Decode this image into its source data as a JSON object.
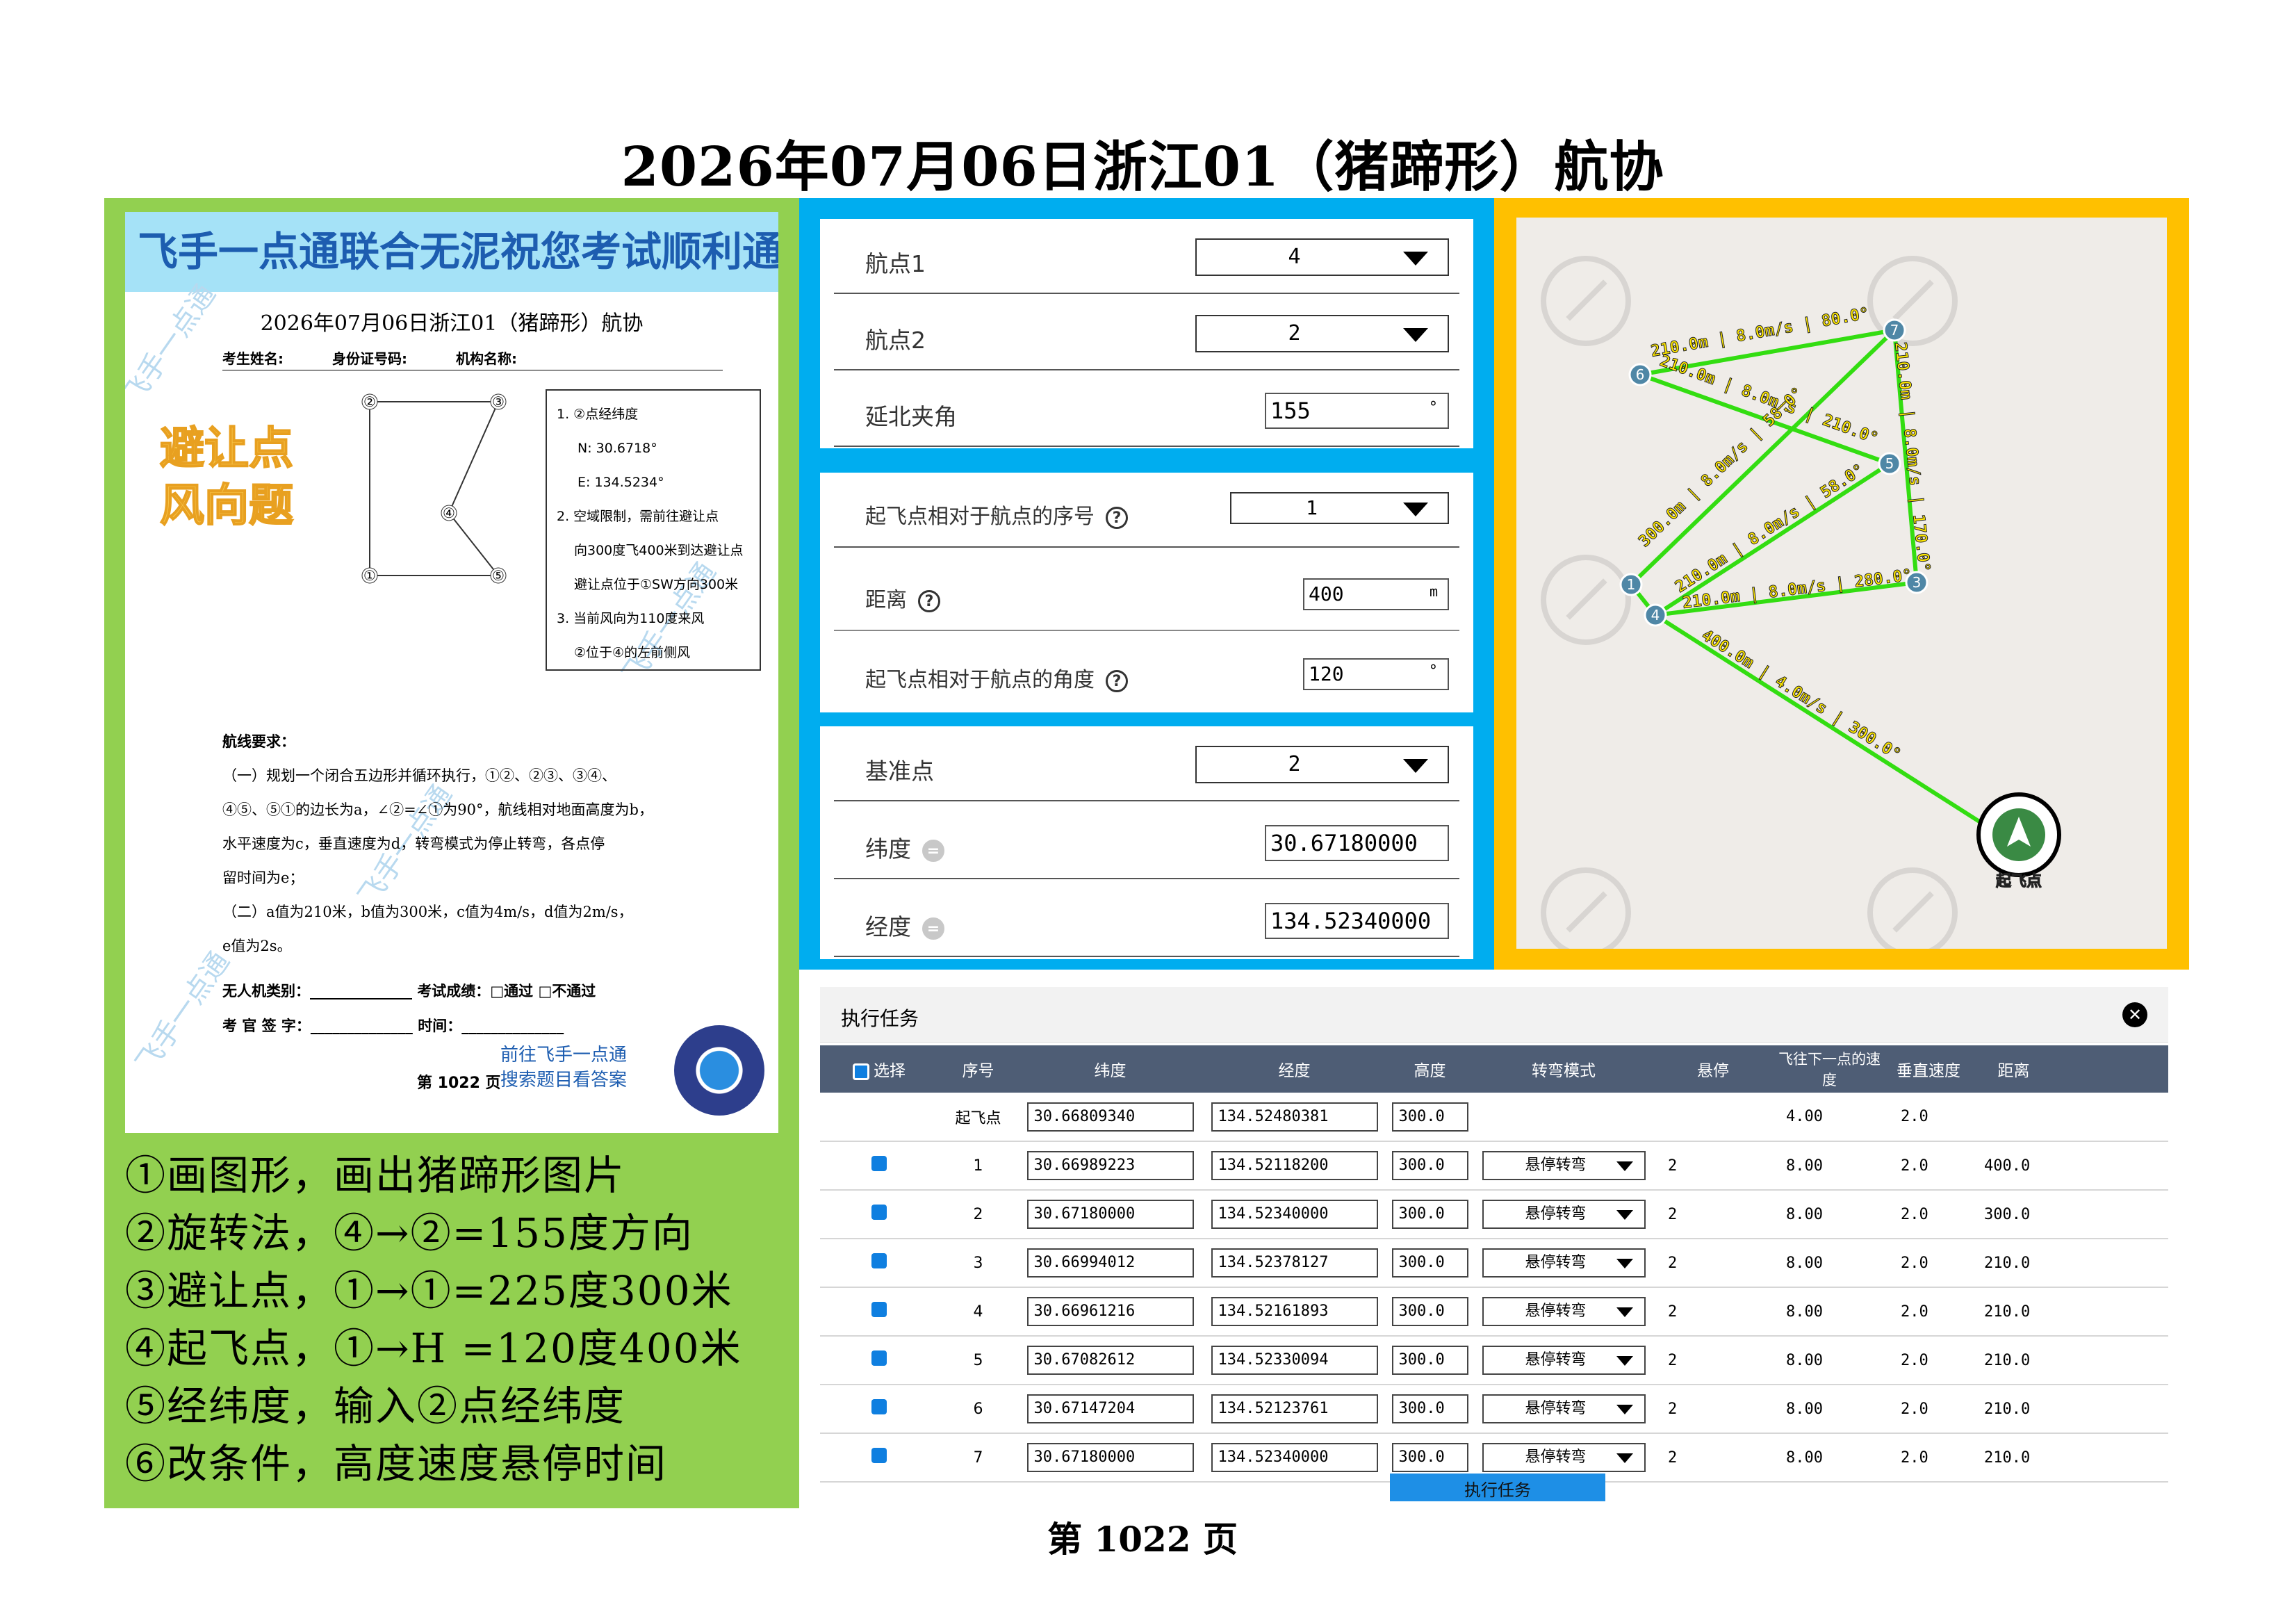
{
  "page_title": "2026年07月06日浙江01（猪蹄形）航协",
  "footer": "第 1022 页",
  "sheet": {
    "banner": "飞手一点通联合无泥祝您考试顺利通过",
    "watermark": "飞手一点通",
    "title": "2026年07月06日浙江01（猪蹄形）航协",
    "field_name": "考生姓名:",
    "field_id": "身份证号码:",
    "field_org": "机构名称:",
    "badge_line1": "避让点",
    "badge_line2": "风向题",
    "diagram_labels": [
      "②",
      "③",
      "④",
      "①",
      "⑤"
    ],
    "info_lines": [
      "1. ②点经纬度",
      "N: 30.6718°",
      "E: 134.5234°",
      "2. 空域限制，需前往避让点",
      "向300度飞400米到达避让点",
      "避让点位于①SW方向300米",
      "3. 当前风向为110度来风",
      "②位于④的左前侧风"
    ],
    "req_heading": "航线要求：",
    "req_lines": [
      "（一）规划一个闭合五边形并循环执行，①②、②③、③④、",
      "④⑤、⑤①的边长为a，∠②=∠①为90°，航线相对地面高度为b，",
      "水平速度为c，垂直速度为d，转弯模式为停止转弯，各点停",
      "留时间为e；",
      "（二）a值为210米，b值为300米，c值为4m/s，d值为2m/s，",
      "e值为2s。"
    ],
    "uav_type": "无人机类别：______________",
    "exam_result": "考试成绩：□通过  □不通过",
    "examiner": "考 官 签 字：______________",
    "time": "时间：______________",
    "promo_line1": "前往飞手一点通",
    "promo_line2": "搜索题目看答案",
    "page_small": "第 1022 页"
  },
  "steps": [
    "①画图形，画出猪蹄形图片",
    "②旋转法，④→②=155度方向",
    "③避让点，①→①=225度300米",
    "④起飞点，①→H =120度400米",
    "⑤经纬度，输入②点经纬度",
    "⑥改条件，高度速度悬停时间"
  ],
  "form1": {
    "wp1_label": "航点1",
    "wp1_value": "4",
    "wp2_label": "航点2",
    "wp2_value": "2",
    "angle_label": "延北夹角",
    "angle_value": "155",
    "angle_unit": "°"
  },
  "form2": {
    "seq_label": "起飞点相对于航点的序号",
    "seq_value": "1",
    "dist_label": "距离",
    "dist_value": "400",
    "dist_unit": "m",
    "ang_label": "起飞点相对于航点的角度",
    "ang_value": "120",
    "ang_unit": "°",
    "help_glyph": "?"
  },
  "form3": {
    "base_label": "基准点",
    "base_value": "2",
    "lat_label": "纬度",
    "lat_value": "30.67180000",
    "lon_label": "经度",
    "lon_value": "134.52340000",
    "copy_glyph": "="
  },
  "map": {
    "home_label": "起飞点",
    "nodes": [
      "1",
      "3",
      "4",
      "5",
      "6",
      "7"
    ],
    "edges": [
      "210.0m | 8.0m/s | 80.0°",
      "210.0m | 8.0m/s | 210.0°",
      "210.0m | 8.0m/s | 200.0°",
      "300.0m | 8.0m/s | 58.0°",
      "210.0m | 8.0m/s | 58.0°",
      "210.0m | 8.0m/s | 170.0°",
      "210.0m | 8.0m/s | 20.0°",
      "210.0m | 8.0m/s | 280.0°",
      "400.0m | 4.0m/s | 300.0°"
    ]
  },
  "task": {
    "title": "执行任务",
    "close_glyph": "✕",
    "columns": [
      "选择",
      "序号",
      "纬度",
      "经度",
      "高度",
      "转弯模式",
      "悬停",
      "飞往下一点的速度",
      "垂直速度",
      "距离"
    ],
    "rows": [
      {
        "seq": "起飞点",
        "lat": "30.66809340",
        "lon": "134.52480381",
        "alt": "300.0",
        "mode": "",
        "hover": "",
        "speed": "4.00",
        "vspeed": "2.0",
        "dist": ""
      },
      {
        "seq": "1",
        "lat": "30.66989223",
        "lon": "134.52118200",
        "alt": "300.0",
        "mode": "悬停转弯",
        "hover": "2",
        "speed": "8.00",
        "vspeed": "2.0",
        "dist": "400.0"
      },
      {
        "seq": "2",
        "lat": "30.67180000",
        "lon": "134.52340000",
        "alt": "300.0",
        "mode": "悬停转弯",
        "hover": "2",
        "speed": "8.00",
        "vspeed": "2.0",
        "dist": "300.0"
      },
      {
        "seq": "3",
        "lat": "30.66994012",
        "lon": "134.52378127",
        "alt": "300.0",
        "mode": "悬停转弯",
        "hover": "2",
        "speed": "8.00",
        "vspeed": "2.0",
        "dist": "210.0"
      },
      {
        "seq": "4",
        "lat": "30.66961216",
        "lon": "134.52161893",
        "alt": "300.0",
        "mode": "悬停转弯",
        "hover": "2",
        "speed": "8.00",
        "vspeed": "2.0",
        "dist": "210.0"
      },
      {
        "seq": "5",
        "lat": "30.67082612",
        "lon": "134.52330094",
        "alt": "300.0",
        "mode": "悬停转弯",
        "hover": "2",
        "speed": "8.00",
        "vspeed": "2.0",
        "dist": "210.0"
      },
      {
        "seq": "6",
        "lat": "30.67147204",
        "lon": "134.52123761",
        "alt": "300.0",
        "mode": "悬停转弯",
        "hover": "2",
        "speed": "8.00",
        "vspeed": "2.0",
        "dist": "210.0"
      },
      {
        "seq": "7",
        "lat": "30.67180000",
        "lon": "134.52340000",
        "alt": "300.0",
        "mode": "悬停转弯",
        "hover": "2",
        "speed": "8.00",
        "vspeed": "2.0",
        "dist": "210.0"
      }
    ],
    "run_button": "执行任务"
  },
  "colors": {
    "left_panel": "#92d050",
    "mid_panel": "#00adef",
    "map_panel": "#ffc000",
    "route_line": "#33dd11",
    "table_header": "#4e5d75"
  }
}
